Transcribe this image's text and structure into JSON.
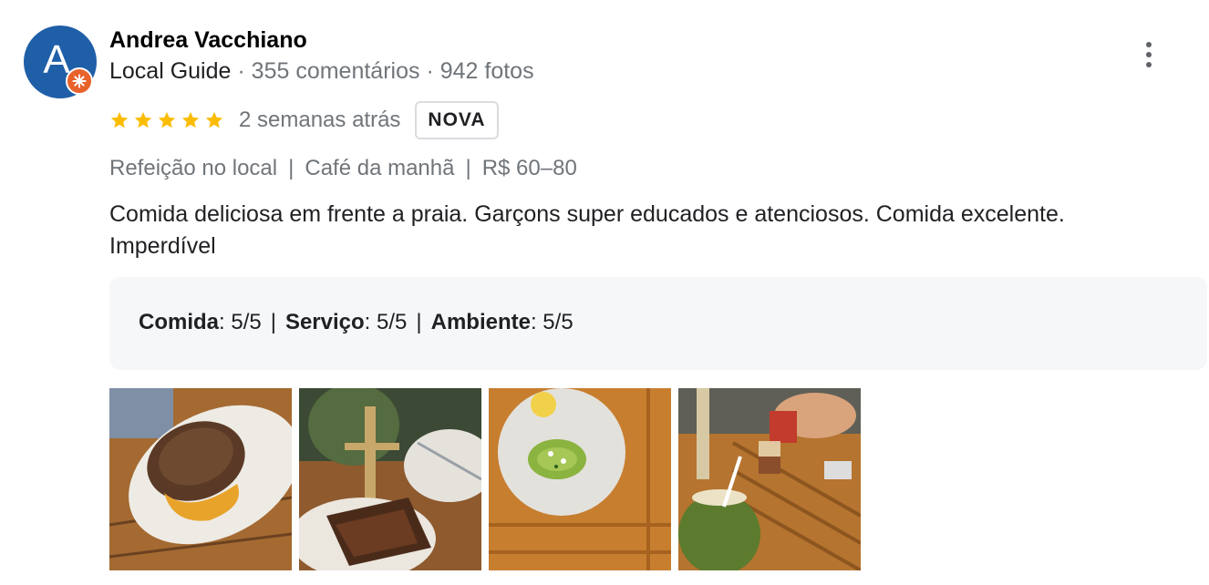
{
  "reviewer": {
    "avatar_letter": "A",
    "name": "Andrea Vacchiano",
    "level": "Local Guide",
    "reviews": "355 comentários",
    "photos": "942 fotos",
    "separator": "·"
  },
  "review": {
    "rating": 5,
    "rating_max": 5,
    "time": "2 semanas atrás",
    "badge": "NOVA",
    "tags": [
      "Refeição no local",
      "Café da manhã",
      "R$ 60–80"
    ],
    "tag_separator": "|",
    "line1": "Comida deliciosa em frente a praia. Garçons super educados e atenciosos. Comida excelente.",
    "line2": "Imperdível"
  },
  "scores": {
    "separator": "|",
    "items": [
      {
        "label": "Comida",
        "value": ": 5/5"
      },
      {
        "label": "Serviço",
        "value": ": 5/5"
      },
      {
        "label": "Ambiente",
        "value": ": 5/5"
      }
    ]
  },
  "colors": {
    "avatar_bg": "#1f5fa8",
    "guide_badge": "#e8622c",
    "star": "#fbbc04",
    "muted_text": "#70757a",
    "score_panel_bg": "#f6f7f9"
  },
  "icons": {
    "more": "more-vert-icon",
    "star": "star-icon",
    "guide": "local-guide-badge-icon"
  }
}
